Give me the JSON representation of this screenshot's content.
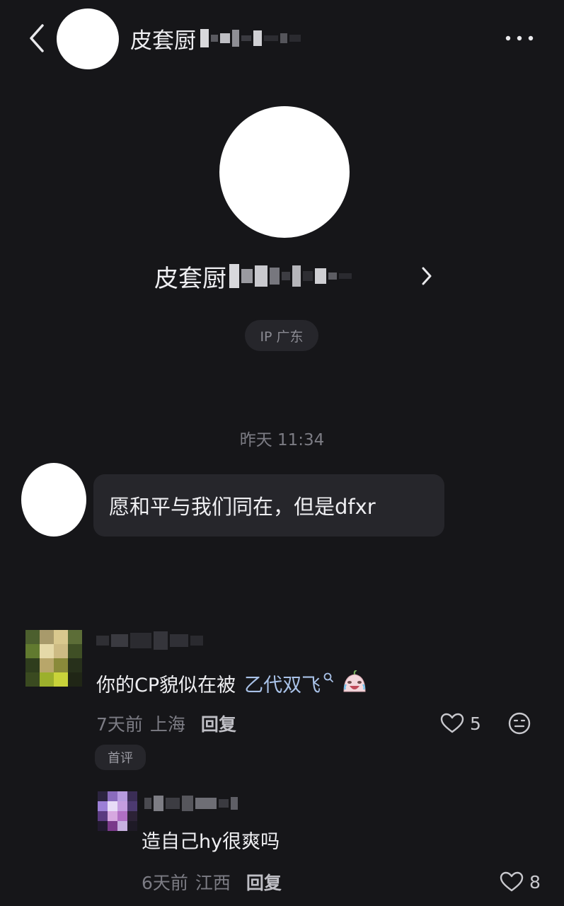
{
  "header": {
    "title": "皮套厨",
    "back_icon": "chevron-left-icon",
    "more_icon": "more-horizontal-icon"
  },
  "profile": {
    "name": "皮套厨",
    "chevron_icon": "chevron-right-icon",
    "ip_label": "IP 广东"
  },
  "chat": {
    "timestamp": "昨天 11:34",
    "message": "愿和平与我们同在，但是dfxr"
  },
  "comments": [
    {
      "text_prefix": "你的CP貌似在被",
      "link_text": "乙代双飞",
      "search_icon": "search-icon",
      "emoji": "crying-laughing-emoji",
      "time": "7天前",
      "location": "上海",
      "reply_label": "回复",
      "likes": "5",
      "badge": "首评",
      "reaction_icon": "emoji-reaction-icon"
    },
    {
      "text": "造自己hy很爽吗",
      "time": "6天前",
      "location": "江西",
      "reply_label": "回复",
      "likes": "8"
    }
  ],
  "colors": {
    "background": "#161619",
    "bubble": "#26262b",
    "link": "#a9c2e8"
  }
}
